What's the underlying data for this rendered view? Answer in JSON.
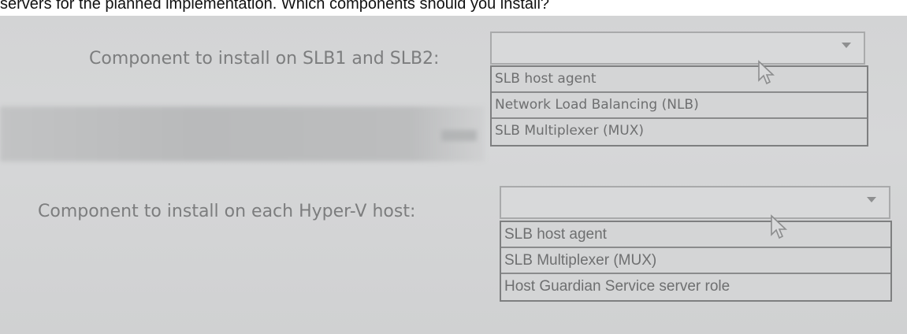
{
  "question": {
    "text": "servers for the planned implementation. Which components should you install?"
  },
  "dropdowns": [
    {
      "label": "Component to install on SLB1 and SLB2:",
      "selected": "",
      "options": [
        "SLB host agent",
        "Network Load Balancing (NLB)",
        "SLB Multiplexer (MUX)"
      ]
    },
    {
      "label": "Component to install on each Hyper-V host:",
      "selected": "",
      "options": [
        "SLB host agent",
        "SLB Multiplexer (MUX)",
        "Host Guardian Service server role"
      ]
    }
  ],
  "icons": {
    "dropdown_arrow": "chevron-down-icon",
    "cursor": "mouse-pointer-icon"
  },
  "colors": {
    "background": "#d3d4d5",
    "label_text": "#7c7d7e",
    "option_text": "#6e6f70",
    "border": "#7e7f80"
  }
}
